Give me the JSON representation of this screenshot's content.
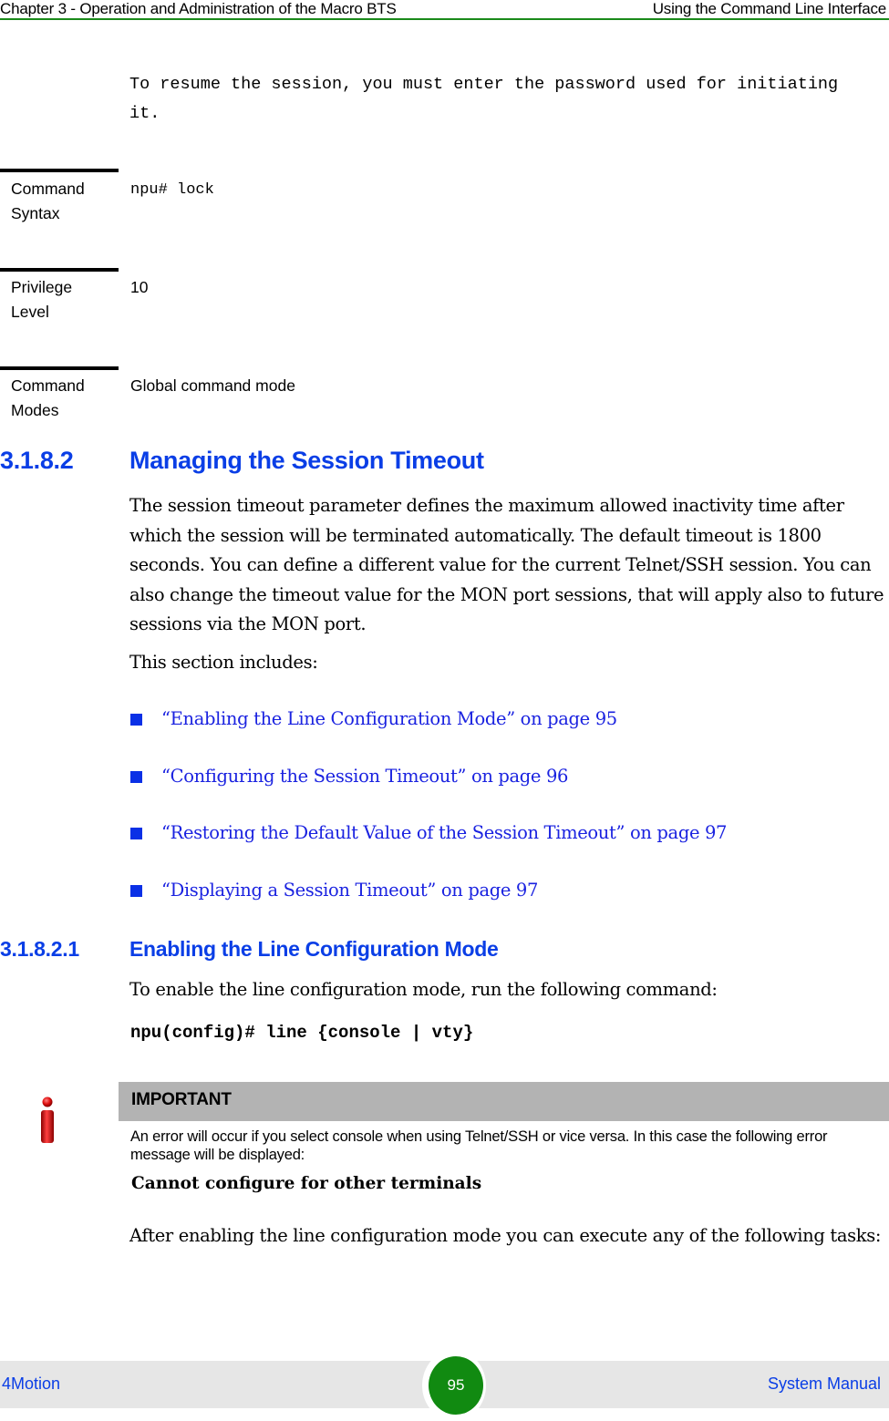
{
  "header": {
    "chapter": "Chapter 3 - Operation and Administration of the Macro BTS",
    "section": "Using the Command Line Interface"
  },
  "intro_text": "To resume the session, you must enter the password used for initiating it.",
  "command_table": [
    {
      "label": "Command Syntax",
      "value": "npu# lock",
      "value_style": "mono"
    },
    {
      "label": "Privilege Level",
      "value": "10",
      "value_style": "sans"
    },
    {
      "label": "Command Modes",
      "value": "Global command mode",
      "value_style": "sans"
    }
  ],
  "section": {
    "number": "3.1.8.2",
    "title": "Managing the Session Timeout",
    "paragraph": "The session timeout parameter defines the maximum allowed inactivity time after which the session will be terminated automatically. The default timeout is 1800 seconds. You can define a different value for the current Telnet/SSH session. You can also change the timeout value for the MON port sessions, that will apply also to future sessions via the MON port.",
    "includes_label": "This section includes:",
    "links": [
      "“Enabling the Line Configuration Mode” on page 95",
      "“Configuring the Session Timeout” on page 96",
      "“Restoring the Default Value of the Session Timeout” on page 97",
      "“Displaying a Session Timeout” on page 97"
    ]
  },
  "subsection": {
    "number": "3.1.8.2.1",
    "title": "Enabling the Line Configuration Mode",
    "paragraph": "To enable the line configuration mode, run the following command:",
    "command": "npu(config)# line {console | vty}",
    "important": {
      "heading": "IMPORTANT",
      "body": "An error will occur if you select console when using Telnet/SSH or vice versa. In this case the following error message will be displayed:",
      "code": "Cannot configure for other terminals"
    },
    "after_text": "After enabling the line configuration mode you can execute any of the following tasks:"
  },
  "footer": {
    "left": "4Motion",
    "page_number": "95",
    "right": "System Manual"
  },
  "colors": {
    "heading_blue": "#0a3ee6",
    "link_blue": "#1a22e0",
    "header_rule_green": "#1a8a1a",
    "page_badge_green": "#118a11",
    "important_gray": "#b3b3b3",
    "footer_gray": "#e6e6e6"
  }
}
